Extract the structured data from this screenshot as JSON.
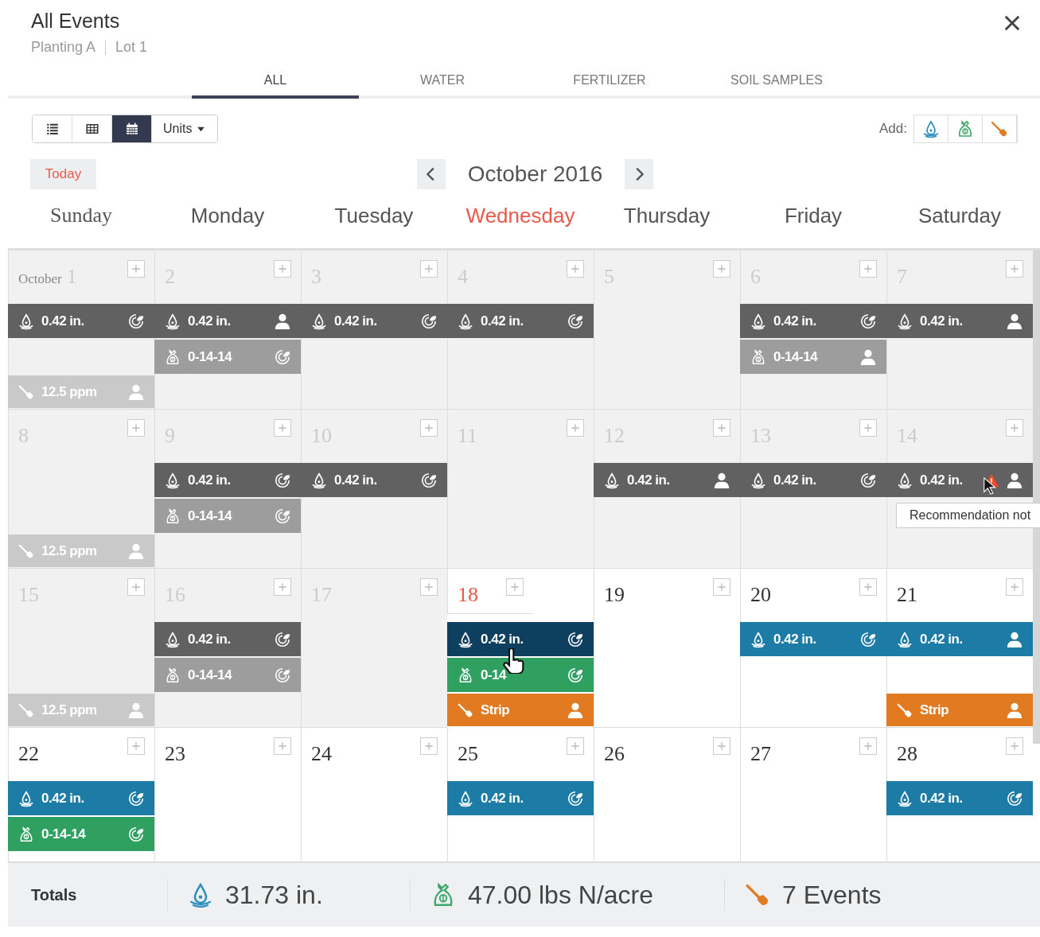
{
  "header": {
    "title": "All Events",
    "breadcrumb": [
      "Planting A",
      "Lot 1"
    ]
  },
  "tabs": [
    {
      "label": "ALL",
      "selected": true
    },
    {
      "label": "WATER",
      "selected": false
    },
    {
      "label": "FERTILIZER",
      "selected": false
    },
    {
      "label": "SOIL SAMPLES",
      "selected": false
    }
  ],
  "toolbar": {
    "views": [
      {
        "kind": "list",
        "selected": false
      },
      {
        "kind": "table",
        "selected": false
      },
      {
        "kind": "calendar",
        "selected": true
      }
    ],
    "units": "Units",
    "add_label": "Add:",
    "add_buttons": [
      {
        "kind": "water"
      },
      {
        "kind": "fertilizer"
      },
      {
        "kind": "soil"
      }
    ]
  },
  "nav": {
    "today": "Today",
    "month": "October 2016"
  },
  "weekdays": [
    {
      "label": "Sunday",
      "today": false
    },
    {
      "label": "Monday",
      "today": false
    },
    {
      "label": "Tuesday",
      "today": false
    },
    {
      "label": "Wednesday",
      "today": true
    },
    {
      "label": "Thursday",
      "today": false
    },
    {
      "label": "Friday",
      "today": false
    },
    {
      "label": "Saturday",
      "today": false
    }
  ],
  "weeks": [
    {
      "days": [
        {
          "month_label": "October",
          "number": "1",
          "past": true,
          "today": false,
          "events": [
            {
              "kind": "water",
              "label": "0.42 in.",
              "manual": false,
              "highlighted": false,
              "warning": false
            },
            {
              "kind": "soil",
              "label": "12.5 ppm",
              "manual": true,
              "highlighted": false,
              "warning": false
            }
          ]
        },
        {
          "number": "2",
          "past": true,
          "today": false,
          "events": [
            {
              "kind": "water",
              "label": "0.42 in.",
              "manual": true,
              "highlighted": false,
              "warning": false
            },
            {
              "kind": "fertilizer",
              "label": "0-14-14",
              "manual": false,
              "highlighted": false,
              "warning": false
            }
          ]
        },
        {
          "number": "3",
          "past": true,
          "today": false,
          "events": [
            {
              "kind": "water",
              "label": "0.42 in.",
              "manual": false,
              "highlighted": false,
              "warning": false
            }
          ]
        },
        {
          "number": "4",
          "past": true,
          "today": false,
          "events": [
            {
              "kind": "water",
              "label": "0.42 in.",
              "manual": false,
              "highlighted": false,
              "warning": false
            }
          ]
        },
        {
          "number": "5",
          "past": true,
          "today": false
        },
        {
          "number": "6",
          "past": true,
          "today": false,
          "events": [
            {
              "kind": "water",
              "label": "0.42 in.",
              "manual": false,
              "highlighted": false,
              "warning": false
            },
            {
              "kind": "fertilizer",
              "label": "0-14-14",
              "manual": true,
              "highlighted": false,
              "warning": false
            }
          ]
        },
        {
          "number": "7",
          "past": true,
          "today": false,
          "events": [
            {
              "kind": "water",
              "label": "0.42 in.",
              "manual": true,
              "highlighted": false,
              "warning": false
            }
          ]
        }
      ]
    },
    {
      "days": [
        {
          "number": "8",
          "past": true,
          "today": false,
          "events": [
            {
              "kind": "soil",
              "label": "12.5 ppm",
              "manual": true,
              "highlighted": false,
              "warning": false
            }
          ]
        },
        {
          "number": "9",
          "past": true,
          "today": false,
          "events": [
            {
              "kind": "water",
              "label": "0.42 in.",
              "manual": false,
              "highlighted": false,
              "warning": false
            },
            {
              "kind": "fertilizer",
              "label": "0-14-14",
              "manual": false,
              "highlighted": false,
              "warning": false
            }
          ]
        },
        {
          "number": "10",
          "past": true,
          "today": false,
          "events": [
            {
              "kind": "water",
              "label": "0.42 in.",
              "manual": false,
              "highlighted": false,
              "warning": false
            }
          ]
        },
        {
          "number": "11",
          "past": true,
          "today": false
        },
        {
          "number": "12",
          "past": true,
          "today": false,
          "events": [
            {
              "kind": "water",
              "label": "0.42 in.",
              "manual": true,
              "highlighted": false,
              "warning": false
            }
          ]
        },
        {
          "number": "13",
          "past": true,
          "today": false,
          "events": [
            {
              "kind": "water",
              "label": "0.42 in.",
              "manual": false,
              "highlighted": false,
              "warning": false
            }
          ]
        },
        {
          "number": "14",
          "past": true,
          "today": false,
          "events": [
            {
              "kind": "water",
              "label": "0.42 in.",
              "manual": true,
              "highlighted": false,
              "warning": true,
              "cursor": {
                "kind": "arrow"
              },
              "tooltip": "Recommendation not"
            }
          ]
        }
      ]
    },
    {
      "days": [
        {
          "number": "15",
          "past": true,
          "today": false,
          "events": [
            {
              "kind": "soil",
              "label": "12.5 ppm",
              "manual": true,
              "highlighted": false,
              "warning": false
            }
          ]
        },
        {
          "number": "16",
          "past": true,
          "today": false,
          "events": [
            {
              "kind": "water",
              "label": "0.42 in.",
              "manual": false,
              "highlighted": false,
              "warning": false
            },
            {
              "kind": "fertilizer",
              "label": "0-14-14",
              "manual": false,
              "highlighted": false,
              "warning": false
            }
          ]
        },
        {
          "number": "17",
          "past": true,
          "today": false
        },
        {
          "number": "18",
          "past": false,
          "today": true,
          "events": [
            {
              "kind": "water",
              "label": "0.42 in.",
              "manual": false,
              "highlighted": true,
              "warning": false
            },
            {
              "kind": "fertilizer",
              "label": "0-14",
              "manual": false,
              "highlighted": false,
              "warning": false,
              "cursor": {
                "kind": "hand"
              }
            },
            {
              "kind": "soil",
              "label": "Strip",
              "manual": true,
              "highlighted": false,
              "warning": false
            }
          ]
        },
        {
          "number": "19",
          "past": false,
          "today": false
        },
        {
          "number": "20",
          "past": false,
          "today": false,
          "events": [
            {
              "kind": "water",
              "label": "0.42 in.",
              "manual": false,
              "highlighted": false,
              "warning": false
            }
          ]
        },
        {
          "number": "21",
          "past": false,
          "today": false,
          "events": [
            {
              "kind": "water",
              "label": "0.42 in.",
              "manual": true,
              "highlighted": false,
              "warning": false
            },
            {
              "kind": "soil",
              "label": "Strip",
              "manual": true,
              "highlighted": false,
              "warning": false
            }
          ]
        }
      ]
    },
    {
      "days": [
        {
          "number": "22",
          "past": false,
          "today": false,
          "events": [
            {
              "kind": "water",
              "label": "0.42 in.",
              "manual": false,
              "highlighted": false,
              "warning": false
            },
            {
              "kind": "fertilizer",
              "label": "0-14-14",
              "manual": false,
              "highlighted": false,
              "warning": false
            }
          ]
        },
        {
          "number": "23",
          "past": false,
          "today": false
        },
        {
          "number": "24",
          "past": false,
          "today": false
        },
        {
          "number": "25",
          "past": false,
          "today": false,
          "events": [
            {
              "kind": "water",
              "label": "0.42 in.",
              "manual": false,
              "highlighted": false,
              "warning": false
            }
          ]
        },
        {
          "number": "26",
          "past": false,
          "today": false
        },
        {
          "number": "27",
          "past": false,
          "today": false
        },
        {
          "number": "28",
          "past": false,
          "today": false,
          "events": [
            {
              "kind": "water",
              "label": "0.42 in.",
              "manual": false,
              "highlighted": false,
              "warning": false
            }
          ]
        }
      ]
    }
  ],
  "totals": {
    "label": "Totals",
    "items": [
      {
        "kind": "water",
        "text": "31.73 in."
      },
      {
        "kind": "fertilizer",
        "text": "47.00 lbs N/acre"
      },
      {
        "kind": "soil",
        "text": "7 Events"
      }
    ]
  }
}
